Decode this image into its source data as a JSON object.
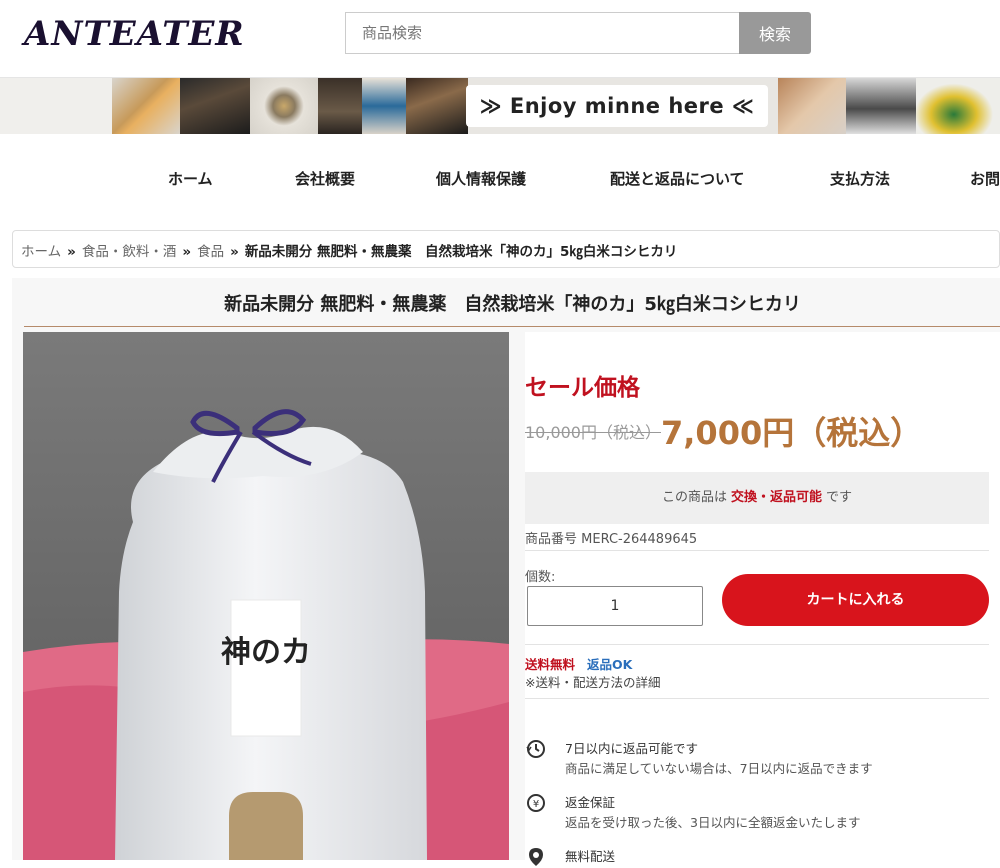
{
  "header": {
    "logo": "ANTEATER",
    "search_placeholder": "商品検索",
    "search_button": "検索"
  },
  "banner": {
    "cta": "≫ Enjoy minne here ≪"
  },
  "nav": {
    "items": [
      "ホーム",
      "会社概要",
      "個人情報保護",
      "配送と返品について",
      "支払方法",
      "お問"
    ]
  },
  "breadcrumb": {
    "items": [
      "ホーム",
      "食品・飲料・酒",
      "食品"
    ],
    "separator": "»",
    "current": "新品未開分 無肥料・無農薬　自然栽培米「神のカ」5㎏白米コシヒカリ"
  },
  "product": {
    "title": "新品未開分 無肥料・無農薬　自然栽培米「神のカ」5㎏白米コシヒカリ",
    "image_label": "神のカ",
    "sale_label": "セール価格",
    "old_price": "10,000円（税込）",
    "new_price": "7,000円（税込）",
    "return_box": {
      "prefix": "この商品は",
      "highlight": "交換・返品可能",
      "suffix": "です"
    },
    "sku": "商品番号 MERC-264489645",
    "qty_label": "個数:",
    "qty_value": "1",
    "cart_button": "カートに入れる",
    "shipping_free": "送料無料",
    "return_ok": "返品OK",
    "shipping_detail": "※送料・配送方法の詳細",
    "guarantees": [
      {
        "icon": "return-cycle-icon",
        "title": "7日以内に返品可能です",
        "desc": "商品に満足していない場合は、7日以内に返品できます"
      },
      {
        "icon": "yen-coin-icon",
        "title": "返金保証",
        "desc": "返品を受け取った後、3日以内に全額返金いたします"
      },
      {
        "icon": "location-pin-icon",
        "title": "無料配送",
        "desc": ""
      }
    ]
  },
  "colors": {
    "sale_red": "#c0111f",
    "price_brown": "#b5743a",
    "cart_red": "#d8141c",
    "link_blue": "#2a6ebb"
  }
}
